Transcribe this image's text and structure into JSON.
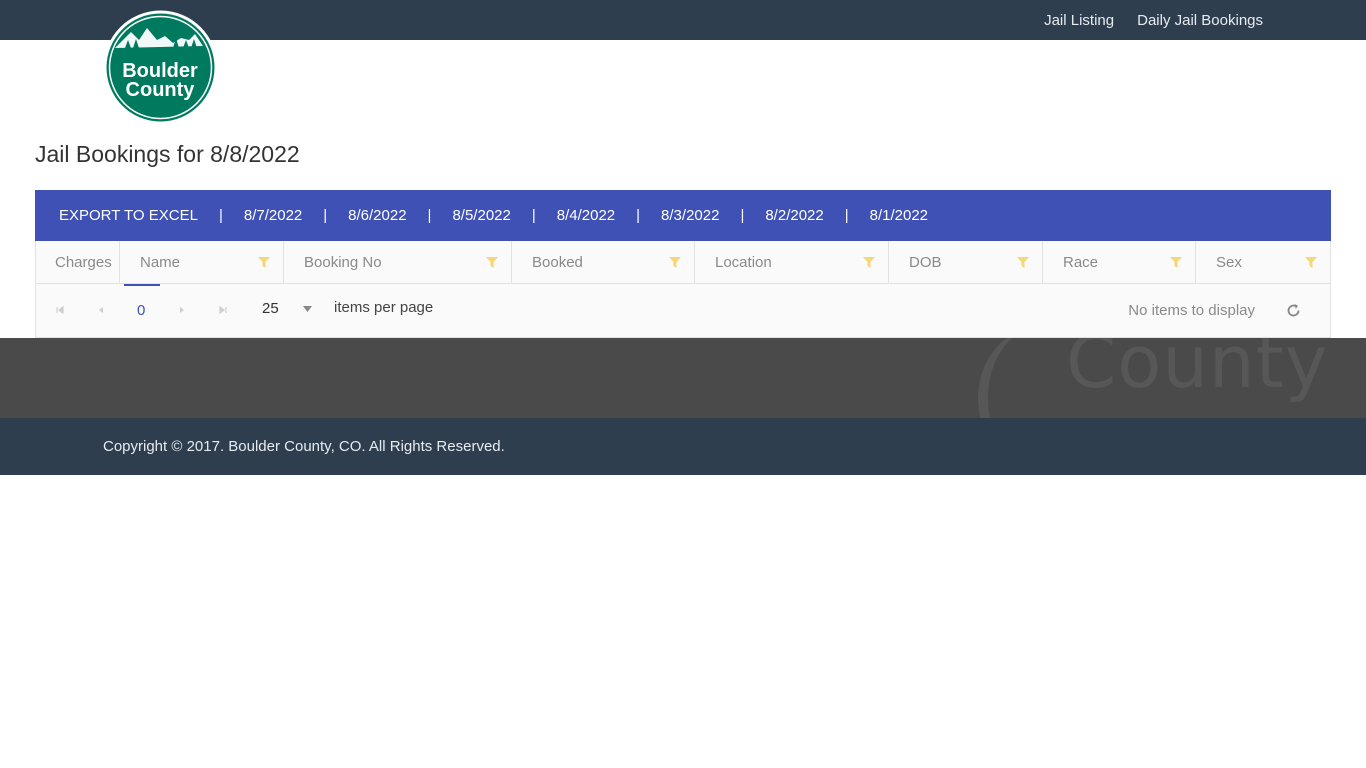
{
  "header": {
    "nav": [
      "Jail Listing",
      "Daily Jail Bookings"
    ]
  },
  "logo": {
    "line1": "Boulder",
    "line2": "County",
    "color": "#007a5e"
  },
  "page": {
    "title": "Jail Bookings for 8/8/2022"
  },
  "toolbar": {
    "export_label": "EXPORT TO EXCEL",
    "dates": [
      "8/7/2022",
      "8/6/2022",
      "8/5/2022",
      "8/4/2022",
      "8/3/2022",
      "8/2/2022",
      "8/1/2022"
    ],
    "separator": "|",
    "color": "#3f51b5"
  },
  "grid": {
    "columns": [
      "Charges",
      "Name",
      "Booking No",
      "Booked",
      "Location",
      "DOB",
      "Race",
      "Sex"
    ],
    "filter_icon_color": "#f7d774"
  },
  "pager": {
    "page": "0",
    "page_size": "25",
    "items_label": "items per page",
    "info": "No items to display"
  },
  "band": {
    "watermark": "County"
  },
  "footer": {
    "copyright": "Copyright © 2017. Boulder County, CO. All Rights Reserved."
  }
}
